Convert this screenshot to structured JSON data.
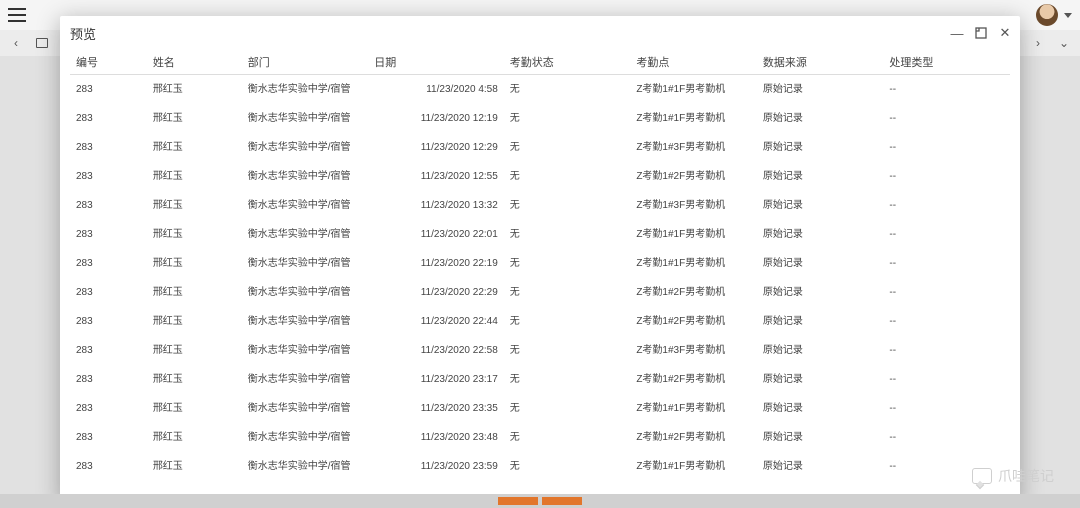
{
  "modal": {
    "title": "预览"
  },
  "columns": [
    "编号",
    "姓名",
    "部门",
    "日期",
    "考勤状态",
    "考勤点",
    "数据来源",
    "处理类型"
  ],
  "dept_value": "衡水志华实验中学/宿管",
  "rows": [
    {
      "id": "283",
      "name": "邢红玉",
      "date": "11/23/2020 4:58",
      "status": "无",
      "point": "Z考勤1#1F男考勤机",
      "source": "原始记录",
      "proc": "--"
    },
    {
      "id": "283",
      "name": "邢红玉",
      "date": "11/23/2020 12:19",
      "status": "无",
      "point": "Z考勤1#1F男考勤机",
      "source": "原始记录",
      "proc": "--"
    },
    {
      "id": "283",
      "name": "邢红玉",
      "date": "11/23/2020 12:29",
      "status": "无",
      "point": "Z考勤1#3F男考勤机",
      "source": "原始记录",
      "proc": "--"
    },
    {
      "id": "283",
      "name": "邢红玉",
      "date": "11/23/2020 12:55",
      "status": "无",
      "point": "Z考勤1#2F男考勤机",
      "source": "原始记录",
      "proc": "--"
    },
    {
      "id": "283",
      "name": "邢红玉",
      "date": "11/23/2020 13:32",
      "status": "无",
      "point": "Z考勤1#3F男考勤机",
      "source": "原始记录",
      "proc": "--"
    },
    {
      "id": "283",
      "name": "邢红玉",
      "date": "11/23/2020 22:01",
      "status": "无",
      "point": "Z考勤1#1F男考勤机",
      "source": "原始记录",
      "proc": "--"
    },
    {
      "id": "283",
      "name": "邢红玉",
      "date": "11/23/2020 22:19",
      "status": "无",
      "point": "Z考勤1#1F男考勤机",
      "source": "原始记录",
      "proc": "--"
    },
    {
      "id": "283",
      "name": "邢红玉",
      "date": "11/23/2020 22:29",
      "status": "无",
      "point": "Z考勤1#2F男考勤机",
      "source": "原始记录",
      "proc": "--"
    },
    {
      "id": "283",
      "name": "邢红玉",
      "date": "11/23/2020 22:44",
      "status": "无",
      "point": "Z考勤1#2F男考勤机",
      "source": "原始记录",
      "proc": "--"
    },
    {
      "id": "283",
      "name": "邢红玉",
      "date": "11/23/2020 22:58",
      "status": "无",
      "point": "Z考勤1#3F男考勤机",
      "source": "原始记录",
      "proc": "--"
    },
    {
      "id": "283",
      "name": "邢红玉",
      "date": "11/23/2020 23:17",
      "status": "无",
      "point": "Z考勤1#2F男考勤机",
      "source": "原始记录",
      "proc": "--"
    },
    {
      "id": "283",
      "name": "邢红玉",
      "date": "11/23/2020 23:35",
      "status": "无",
      "point": "Z考勤1#1F男考勤机",
      "source": "原始记录",
      "proc": "--"
    },
    {
      "id": "283",
      "name": "邢红玉",
      "date": "11/23/2020 23:48",
      "status": "无",
      "point": "Z考勤1#2F男考勤机",
      "source": "原始记录",
      "proc": "--"
    },
    {
      "id": "283",
      "name": "邢红玉",
      "date": "11/23/2020 23:59",
      "status": "无",
      "point": "Z考勤1#1F男考勤机",
      "source": "原始记录",
      "proc": "--"
    }
  ],
  "watermark": "爪哇笔记"
}
